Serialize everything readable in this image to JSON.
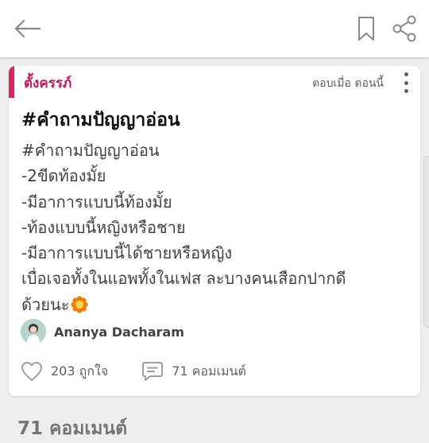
{
  "topbar": {
    "back_icon": "back-arrow-icon",
    "bookmark_icon": "bookmark-icon",
    "share_icon": "share-icon"
  },
  "post": {
    "tag": "ตั้งครรภ์",
    "status": "ตอบเมื่อ ตอนนี้",
    "title": "#คำถามปัญญาอ่อน",
    "body_lines": [
      "#คำถามปัญญาอ่อน",
      "-2ขีดท้องมั้ย",
      "-มีอาการแบบนี้ท้องมั้ย",
      "-ท้องแบบนี้หญิงหรือชาย",
      "-มีอาการแบบนี้ได้ชายหรือหญิง",
      "เบื่อเจอทั้งในแอพทั้งในเฟส ละบางคนเสือกปากดี",
      "ด้วยนะ"
    ],
    "author": "Ananya Dacharam",
    "likes": "203 ถูกใจ",
    "comments": "71 คอมเมนต์"
  },
  "comments_section": {
    "heading": "71 คอมเมนต์"
  },
  "colors": {
    "accent": "#e0245e",
    "tag_text": "#c2185b",
    "background": "#eeeeee"
  }
}
